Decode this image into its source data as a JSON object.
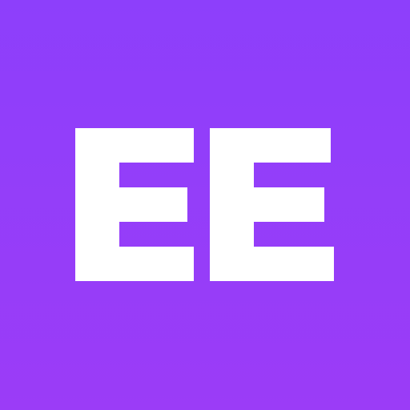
{
  "logo": {
    "text": "EE",
    "kind": "wordmark-logo"
  },
  "colors": {
    "background_top": "#8d3ffb",
    "background_bottom": "#9b3cf7",
    "letter_fill": "#ffffff"
  }
}
